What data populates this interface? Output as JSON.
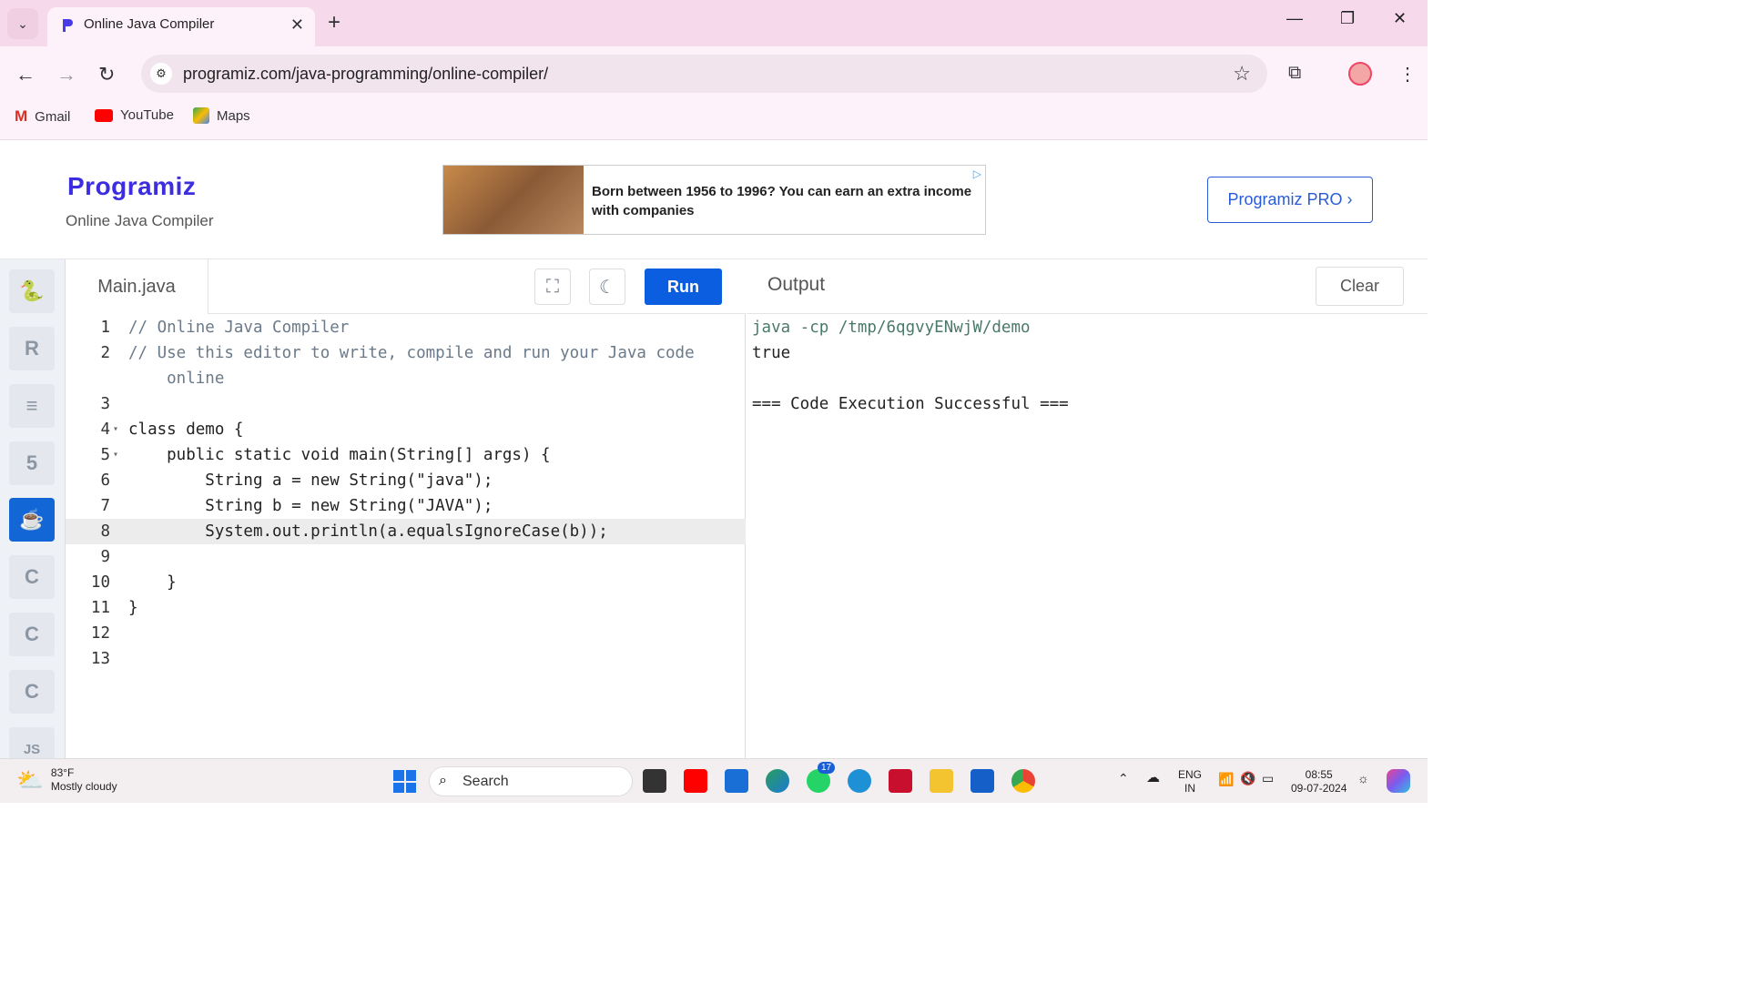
{
  "browser": {
    "tab_title": "Online Java Compiler",
    "url": "programiz.com/java-programming/online-compiler/",
    "bookmarks": [
      "Gmail",
      "YouTube",
      "Maps"
    ]
  },
  "header": {
    "logo": "Programiz",
    "subtitle": "Online Java Compiler",
    "ad_text": "Born between 1956 to 1996? You can earn an extra income with companies",
    "pro_button": "Programiz PRO ›"
  },
  "sidebar": {
    "languages": [
      "python-icon",
      "r-icon",
      "sql-icon",
      "html5-icon",
      "java-icon",
      "c-icon",
      "cpp-icon",
      "csharp-icon",
      "js-icon"
    ],
    "js_label": "JS",
    "active": "java-icon"
  },
  "editor": {
    "file_tab": "Main.java",
    "run_label": "Run",
    "active_line": 8
  },
  "code": {
    "lines": [
      {
        "n": "1",
        "text": "// Online Java Compiler"
      },
      {
        "n": "2",
        "text": "// Use this editor to write, compile and run your Java code"
      },
      {
        "n": "",
        "text": "    online"
      },
      {
        "n": "3",
        "text": ""
      },
      {
        "n": "4",
        "text": "class demo {"
      },
      {
        "n": "5",
        "text": "    public static void main(String[] args) {"
      },
      {
        "n": "6",
        "text": "        String a = new String(\"java\");"
      },
      {
        "n": "7",
        "text": "        String b = new String(\"JAVA\");"
      },
      {
        "n": "8",
        "text": "        System.out.println(a.equalsIgnoreCase(b));"
      },
      {
        "n": "9",
        "text": ""
      },
      {
        "n": "10",
        "text": "    }"
      },
      {
        "n": "11",
        "text": "}"
      },
      {
        "n": "12",
        "text": ""
      },
      {
        "n": "13",
        "text": ""
      }
    ]
  },
  "output": {
    "title": "Output",
    "clear_label": "Clear",
    "command": "java -cp /tmp/6qgvyENwjW/demo",
    "result": "true",
    "status": "=== Code Execution Successful ==="
  },
  "taskbar": {
    "temperature": "83°F",
    "weather": "Mostly cloudy",
    "search_label": "Search",
    "whatsapp_badge": "17",
    "lang_line1": "ENG",
    "lang_line2": "IN",
    "time": "08:55",
    "date": "09-07-2024"
  }
}
